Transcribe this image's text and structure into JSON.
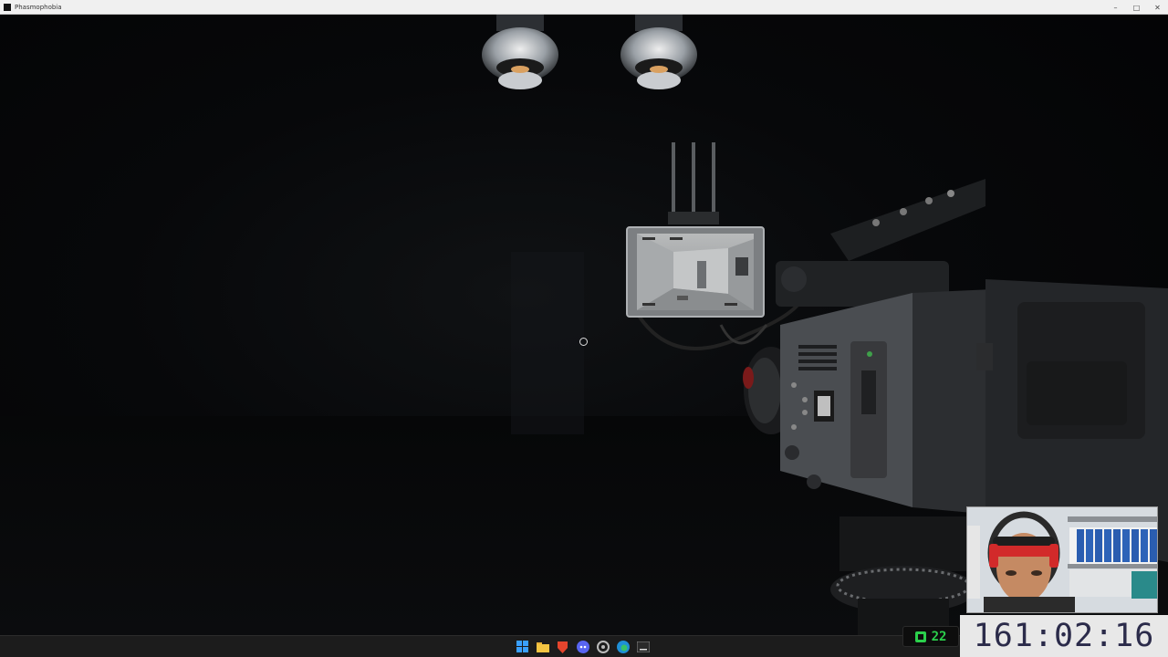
{
  "window": {
    "title": "Phasmophobia",
    "minimize": "–",
    "maximize": "□",
    "close": "✕"
  },
  "hud": {
    "counter_value": "22",
    "timer": "161:02:16"
  },
  "taskbar": {
    "icons": [
      "windows-start-icon",
      "file-explorer-icon",
      "brave-browser-icon",
      "discord-icon",
      "settings-icon",
      "edge-browser-icon",
      "terminal-icon"
    ]
  },
  "colors": {
    "counter_green": "#2bd04c",
    "timer_text": "#2b2b4a",
    "taskbar": "#1c1c1c"
  }
}
